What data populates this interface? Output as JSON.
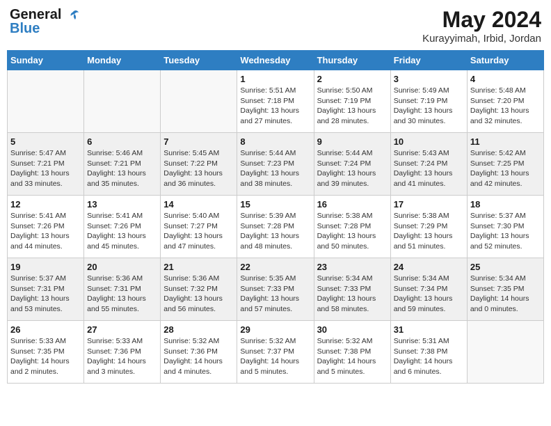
{
  "header": {
    "logo_line1": "General",
    "logo_line2": "Blue",
    "month_title": "May 2024",
    "location": "Kurayyimah, Irbid, Jordan"
  },
  "weekdays": [
    "Sunday",
    "Monday",
    "Tuesday",
    "Wednesday",
    "Thursday",
    "Friday",
    "Saturday"
  ],
  "weeks": [
    [
      {
        "day": "",
        "info": ""
      },
      {
        "day": "",
        "info": ""
      },
      {
        "day": "",
        "info": ""
      },
      {
        "day": "1",
        "info": "Sunrise: 5:51 AM\nSunset: 7:18 PM\nDaylight: 13 hours and 27 minutes."
      },
      {
        "day": "2",
        "info": "Sunrise: 5:50 AM\nSunset: 7:19 PM\nDaylight: 13 hours and 28 minutes."
      },
      {
        "day": "3",
        "info": "Sunrise: 5:49 AM\nSunset: 7:19 PM\nDaylight: 13 hours and 30 minutes."
      },
      {
        "day": "4",
        "info": "Sunrise: 5:48 AM\nSunset: 7:20 PM\nDaylight: 13 hours and 32 minutes."
      }
    ],
    [
      {
        "day": "5",
        "info": "Sunrise: 5:47 AM\nSunset: 7:21 PM\nDaylight: 13 hours and 33 minutes."
      },
      {
        "day": "6",
        "info": "Sunrise: 5:46 AM\nSunset: 7:21 PM\nDaylight: 13 hours and 35 minutes."
      },
      {
        "day": "7",
        "info": "Sunrise: 5:45 AM\nSunset: 7:22 PM\nDaylight: 13 hours and 36 minutes."
      },
      {
        "day": "8",
        "info": "Sunrise: 5:44 AM\nSunset: 7:23 PM\nDaylight: 13 hours and 38 minutes."
      },
      {
        "day": "9",
        "info": "Sunrise: 5:44 AM\nSunset: 7:24 PM\nDaylight: 13 hours and 39 minutes."
      },
      {
        "day": "10",
        "info": "Sunrise: 5:43 AM\nSunset: 7:24 PM\nDaylight: 13 hours and 41 minutes."
      },
      {
        "day": "11",
        "info": "Sunrise: 5:42 AM\nSunset: 7:25 PM\nDaylight: 13 hours and 42 minutes."
      }
    ],
    [
      {
        "day": "12",
        "info": "Sunrise: 5:41 AM\nSunset: 7:26 PM\nDaylight: 13 hours and 44 minutes."
      },
      {
        "day": "13",
        "info": "Sunrise: 5:41 AM\nSunset: 7:26 PM\nDaylight: 13 hours and 45 minutes."
      },
      {
        "day": "14",
        "info": "Sunrise: 5:40 AM\nSunset: 7:27 PM\nDaylight: 13 hours and 47 minutes."
      },
      {
        "day": "15",
        "info": "Sunrise: 5:39 AM\nSunset: 7:28 PM\nDaylight: 13 hours and 48 minutes."
      },
      {
        "day": "16",
        "info": "Sunrise: 5:38 AM\nSunset: 7:28 PM\nDaylight: 13 hours and 50 minutes."
      },
      {
        "day": "17",
        "info": "Sunrise: 5:38 AM\nSunset: 7:29 PM\nDaylight: 13 hours and 51 minutes."
      },
      {
        "day": "18",
        "info": "Sunrise: 5:37 AM\nSunset: 7:30 PM\nDaylight: 13 hours and 52 minutes."
      }
    ],
    [
      {
        "day": "19",
        "info": "Sunrise: 5:37 AM\nSunset: 7:31 PM\nDaylight: 13 hours and 53 minutes."
      },
      {
        "day": "20",
        "info": "Sunrise: 5:36 AM\nSunset: 7:31 PM\nDaylight: 13 hours and 55 minutes."
      },
      {
        "day": "21",
        "info": "Sunrise: 5:36 AM\nSunset: 7:32 PM\nDaylight: 13 hours and 56 minutes."
      },
      {
        "day": "22",
        "info": "Sunrise: 5:35 AM\nSunset: 7:33 PM\nDaylight: 13 hours and 57 minutes."
      },
      {
        "day": "23",
        "info": "Sunrise: 5:34 AM\nSunset: 7:33 PM\nDaylight: 13 hours and 58 minutes."
      },
      {
        "day": "24",
        "info": "Sunrise: 5:34 AM\nSunset: 7:34 PM\nDaylight: 13 hours and 59 minutes."
      },
      {
        "day": "25",
        "info": "Sunrise: 5:34 AM\nSunset: 7:35 PM\nDaylight: 14 hours and 0 minutes."
      }
    ],
    [
      {
        "day": "26",
        "info": "Sunrise: 5:33 AM\nSunset: 7:35 PM\nDaylight: 14 hours and 2 minutes."
      },
      {
        "day": "27",
        "info": "Sunrise: 5:33 AM\nSunset: 7:36 PM\nDaylight: 14 hours and 3 minutes."
      },
      {
        "day": "28",
        "info": "Sunrise: 5:32 AM\nSunset: 7:36 PM\nDaylight: 14 hours and 4 minutes."
      },
      {
        "day": "29",
        "info": "Sunrise: 5:32 AM\nSunset: 7:37 PM\nDaylight: 14 hours and 5 minutes."
      },
      {
        "day": "30",
        "info": "Sunrise: 5:32 AM\nSunset: 7:38 PM\nDaylight: 14 hours and 5 minutes."
      },
      {
        "day": "31",
        "info": "Sunrise: 5:31 AM\nSunset: 7:38 PM\nDaylight: 14 hours and 6 minutes."
      },
      {
        "day": "",
        "info": ""
      }
    ]
  ]
}
